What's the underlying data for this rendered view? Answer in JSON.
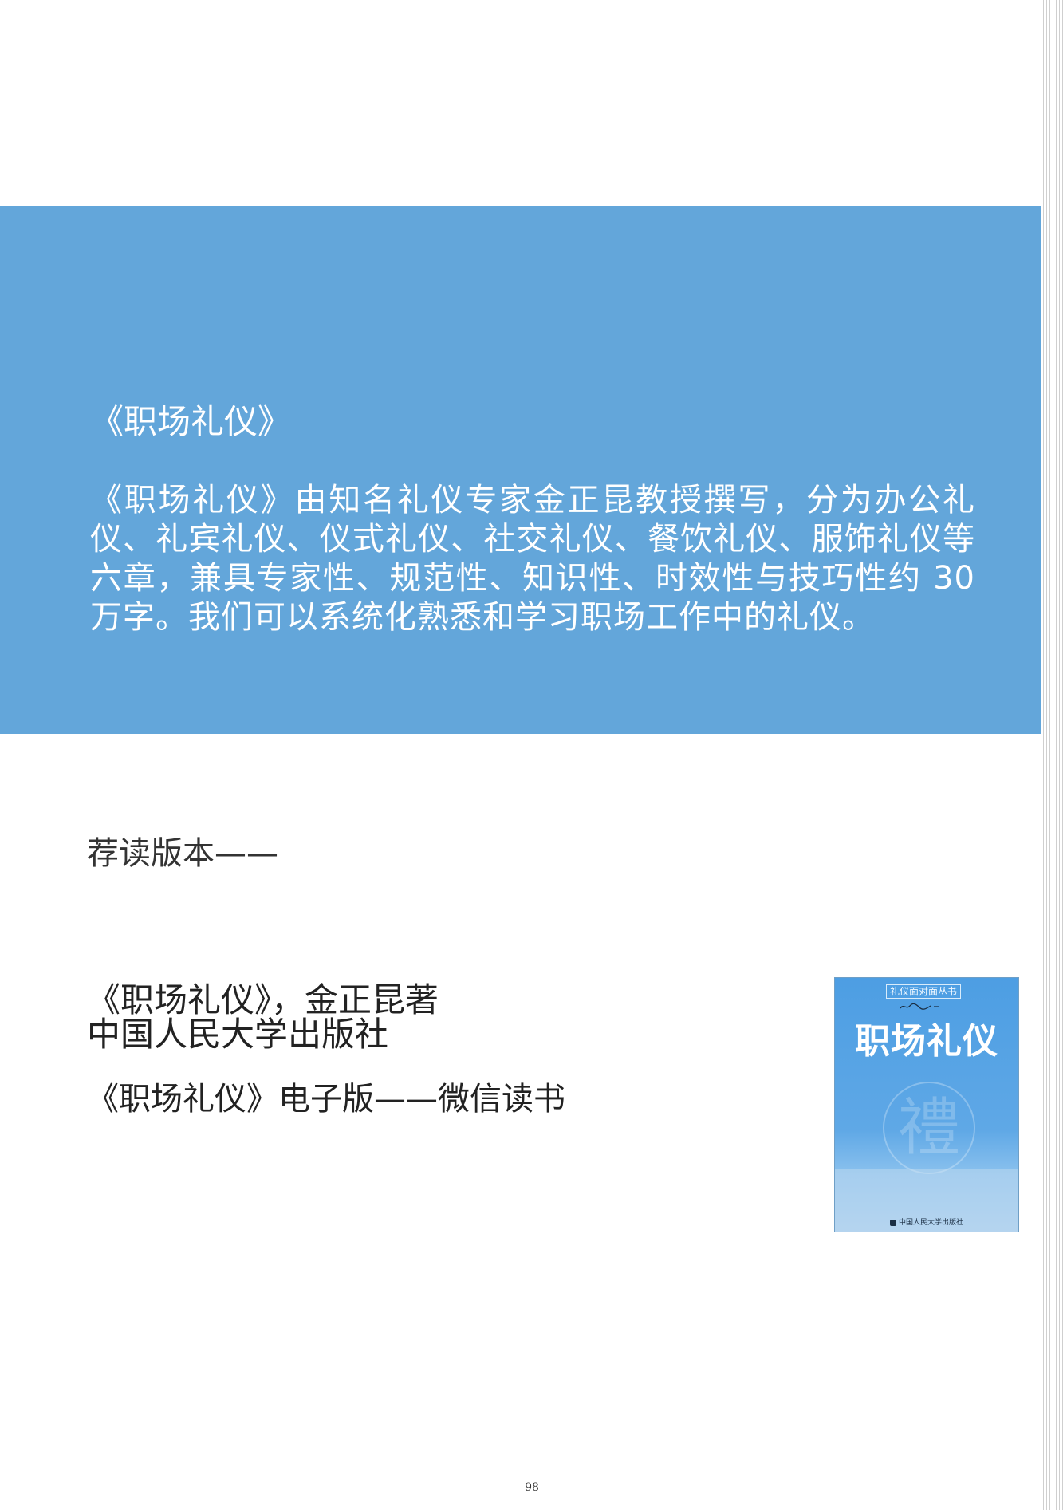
{
  "band": {
    "title": "《职场礼仪》",
    "body": "《职场礼仪》由知名礼仪专家金正昆教授撰写，分为办公礼仪、礼宾礼仪、仪式礼仪、社交礼仪、餐饮礼仪、服饰礼仪等六章，兼具专家性、规范性、知识性、时效性与技巧性约 30 万字。我们可以系统化熟悉和学习职场工作中的礼仪。",
    "color": "#63a6da"
  },
  "recommend": {
    "label": "荐读版本——",
    "book_line1": "《职场礼仪》，金正昆著",
    "book_line2": "中国人民大学出版社",
    "ebook_line": "《职场礼仪》电子版——微信读书"
  },
  "cover": {
    "series": "礼仪面对面丛书",
    "title": "职场礼仪",
    "seal": "禮"
  },
  "page_number": "98"
}
